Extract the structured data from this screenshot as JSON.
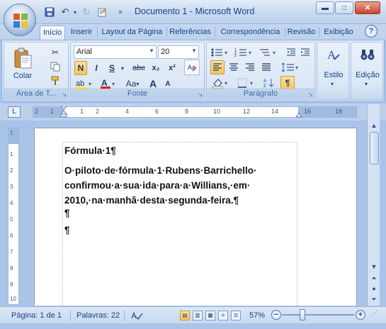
{
  "window": {
    "title": "Documento 1 - Microsoft Word",
    "buttons": [
      "minimize",
      "maximize",
      "close"
    ]
  },
  "quick_access": {
    "icons": [
      "save-icon",
      "undo-icon",
      "redo-icon",
      "paste-icon",
      "customize-icon"
    ]
  },
  "tabs": [
    "Início",
    "Inserir",
    "Layout da Página",
    "Referências",
    "Correspondência",
    "Revisão",
    "Exibição"
  ],
  "active_tab": "Início",
  "ribbon": {
    "clipboard": {
      "paste_label": "Colar",
      "group_label": "Área de T..."
    },
    "font": {
      "font_name": "Arial",
      "font_size": "20",
      "bold": "N",
      "italic": "I",
      "underline": "S",
      "strike": "abc",
      "subscript": "x₂",
      "superscript": "x²",
      "grow": "A",
      "shrink": "A",
      "case": "Aa",
      "group_label": "Fonte"
    },
    "paragraph": {
      "group_label": "Parágrafo",
      "show_marks": "¶"
    },
    "styles": {
      "label": "Estilo"
    },
    "editing": {
      "label": "Edição"
    }
  },
  "ruler": {
    "ticks": [
      "2",
      "1",
      "1",
      "2",
      "4",
      "6",
      "8",
      "10",
      "12",
      "14",
      "16",
      "18"
    ]
  },
  "vruler": {
    "ticks": [
      "1",
      "1",
      "2",
      "3",
      "4",
      "5",
      "6",
      "7",
      "8",
      "9",
      "10"
    ]
  },
  "document": {
    "heading": "Fórmula·1¶",
    "body_line1": "O·piloto·de·fórmula·1·Rubens·Barrichello·",
    "body_line2": "confirmou·a·sua·ida·para·a·Willians,·em·",
    "body_line3": "2010,·na·manhã·desta·segunda-feira.¶",
    "empty1": "¶",
    "empty2": "¶"
  },
  "status": {
    "page": "Página: 1 de 1",
    "words": "Palavras: 22",
    "zoom": "57%",
    "zoom_value": 57
  }
}
